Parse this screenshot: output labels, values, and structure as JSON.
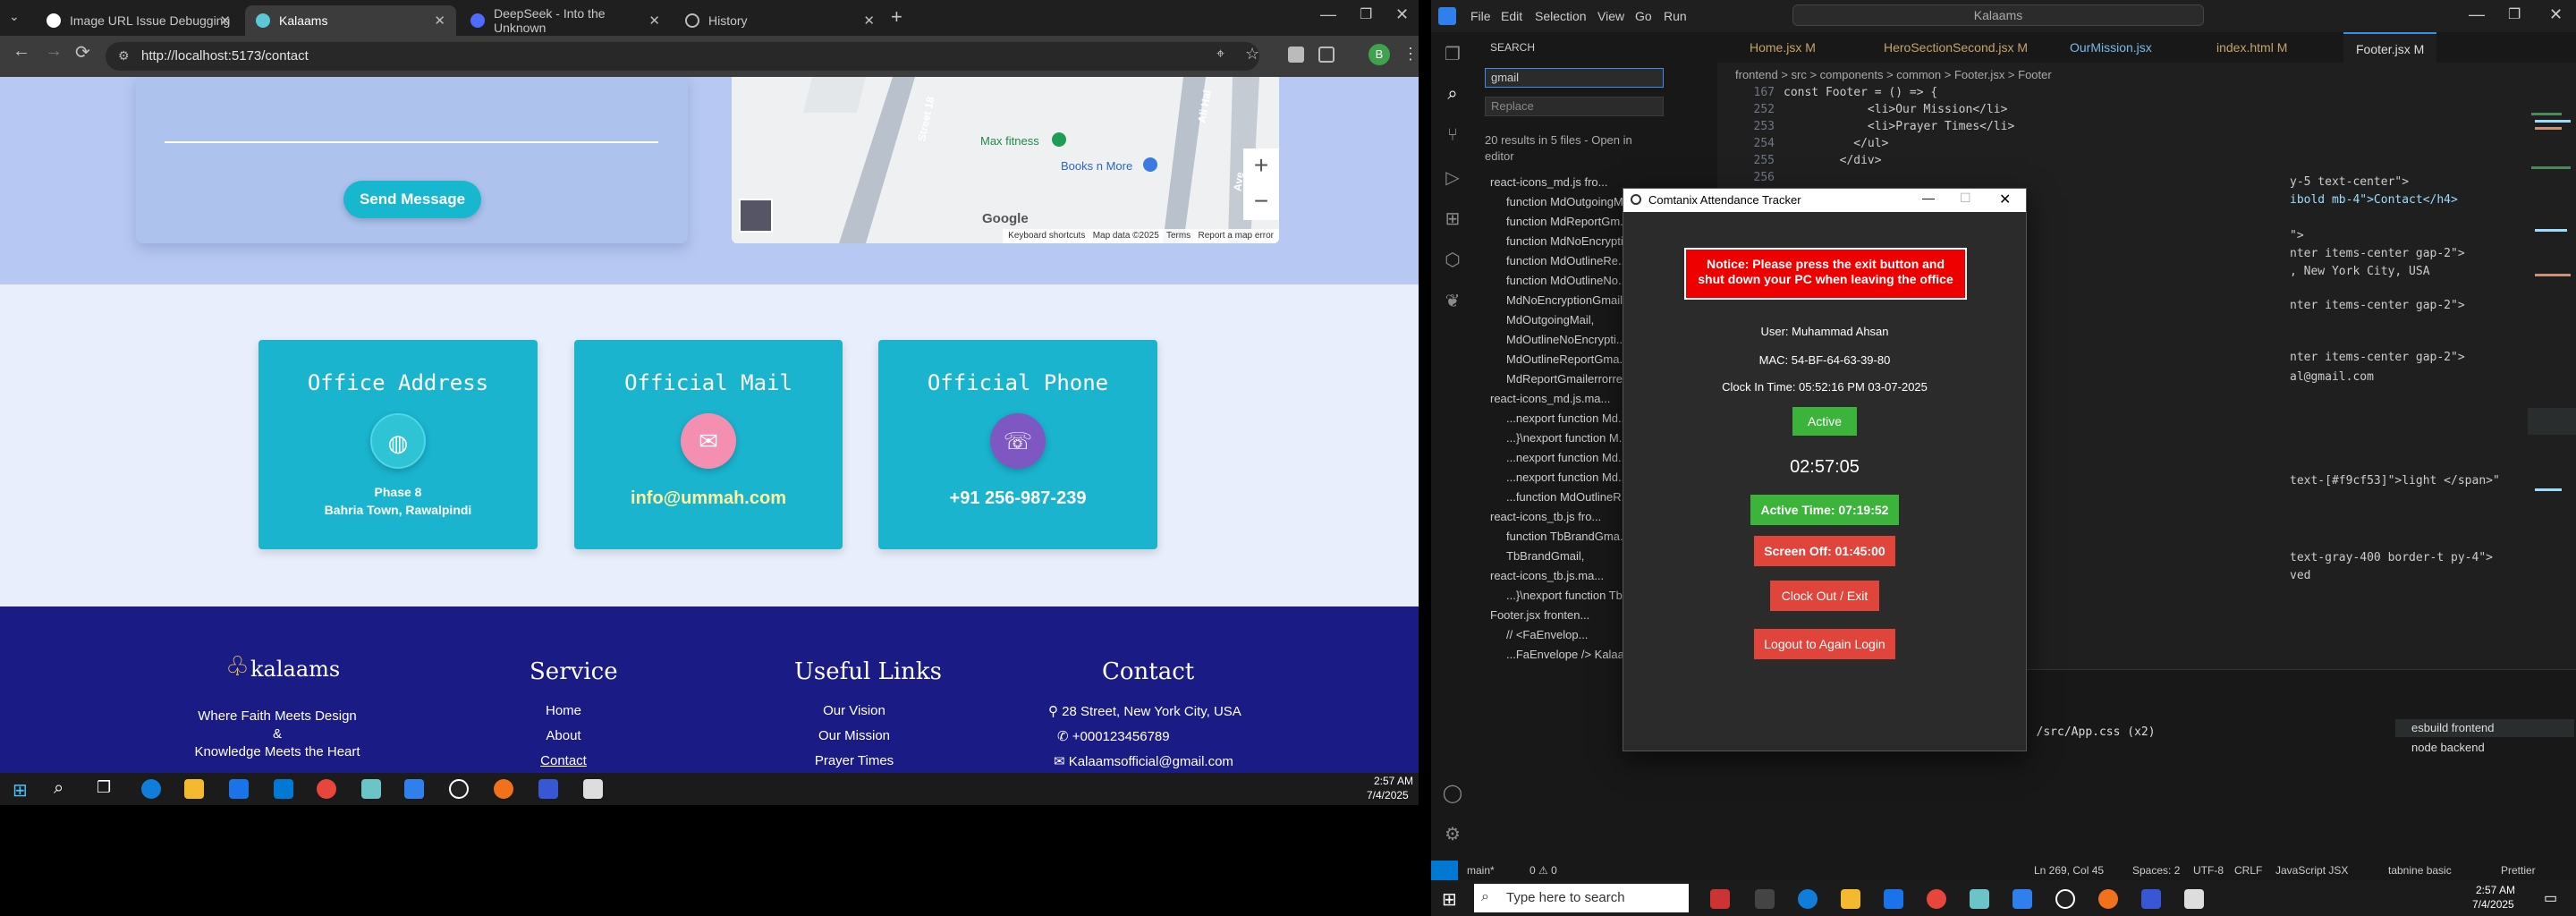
{
  "browser": {
    "tabs": [
      {
        "title": "Image URL Issue Debugging",
        "active": false
      },
      {
        "title": "Kalaams",
        "active": true
      },
      {
        "title": "DeepSeek - Into the Unknown",
        "active": false
      },
      {
        "title": "History",
        "active": false
      }
    ],
    "url": "http://localhost:5173/contact",
    "avatar_letter": "B"
  },
  "page": {
    "send_button": "Send Message",
    "map": {
      "labels": [
        "Max fitness",
        "Books n More",
        "Street 18",
        "Ali Hai",
        "Ave"
      ],
      "google": "Google",
      "footer": [
        "Keyboard shortcuts",
        "Map data ©2025",
        "Terms",
        "Report a map error"
      ],
      "zoom_in": "+",
      "zoom_out": "−"
    },
    "cards": [
      {
        "title": "Office Address",
        "lines": [
          "Phase 8",
          "Bahria Town, Rawalpindi"
        ],
        "icon_color": "#2ec4d6"
      },
      {
        "title": "Official Mail",
        "value": "info@ummah.com",
        "icon_color": "#f48fb1"
      },
      {
        "title": "Official Phone",
        "value": "+91 256-987-239",
        "icon_color": "#7e57c2"
      }
    ],
    "footer": {
      "brand": "kalaams",
      "tagline": [
        "Where Faith Meets Design",
        "&",
        "Knowledge Meets the Heart"
      ],
      "service": {
        "heading": "Service",
        "links": [
          "Home",
          "About",
          "Contact"
        ]
      },
      "useful": {
        "heading": "Useful Links",
        "links": [
          "Our Vision",
          "Our Mission",
          "Prayer Times"
        ]
      },
      "contact": {
        "heading": "Contact",
        "items": [
          "28 Street, New York City, USA",
          "+000123456789",
          "Kalaamsofficial@gmail.com"
        ]
      }
    }
  },
  "left_taskbar": {
    "time": "2:57 AM",
    "date": "7/4/2025"
  },
  "vscode": {
    "menu": [
      "File",
      "Edit",
      "Selection",
      "View",
      "Go",
      "Run"
    ],
    "search_box": "Kalaams",
    "tabs": [
      "Home.jsx M",
      "HeroSectionSecond.jsx M",
      "OurMission.jsx",
      "index.html M",
      "Footer.jsx M"
    ],
    "breadcrumb": "frontend > src > components > common > Footer.jsx > Footer",
    "search_panel": {
      "title": "SEARCH",
      "query": "gmail",
      "replace_placeholder": "Replace",
      "summary": "20 results in 5 files - Open in editor",
      "rows": [
        "react-icons_md.js fro...",
        "function MdOutgoingM...",
        "function MdReportGm...",
        "function MdNoEncrypti...",
        "function MdOutlineRe...",
        "function MdOutlineNo...",
        "MdNoEncryptionGmail...",
        "MdOutgoingMail,",
        "MdOutlineNoEncrypti...",
        "MdOutlineReportGma...",
        "MdReportGmailerrorre...",
        "react-icons_md.js.ma...",
        "...nexport function Md...",
        "...}\\nexport function M...",
        "...nexport function Md...",
        "...nexport function Md...",
        "...function MdOutlineR...",
        "react-icons_tb.js fro...",
        "function TbBrandGma...",
        "TbBrandGmail,",
        "react-icons_tb.js.ma...",
        "...}\\nexport function Tb...",
        "Footer.jsx fronten...",
        "//          <FaEnvelop...",
        "...FaEnvelope /> Kalaa..."
      ]
    },
    "code_top": [
      {
        "n": "167",
        "t": "const Footer = () => {"
      },
      {
        "n": "252",
        "t": "            <li>Our Mission</li>"
      },
      {
        "n": "253",
        "t": "            <li>Prayer Times</li>"
      },
      {
        "n": "254",
        "t": "          </ul>"
      },
      {
        "n": "255",
        "t": "        </div>"
      },
      {
        "n": "256",
        "t": ""
      }
    ],
    "code_right": [
      "y-5 text-center\">",
      "ibold mb-4\">Contact</h4>",
      "\">",
      "nter items-center gap-2\">",
      ", New York City, USA",
      "nter items-center gap-2\">",
      "nter items-center gap-2\">",
      "al@gmail.com",
      "text-[#f9cf53]\">light </span>\"",
      "text-gray-400 border-t py-4\">",
      "ved"
    ],
    "terminal_line": "/common/Footer.jsx, /src/App.css (x2)",
    "terminal_tasks": [
      "esbuild  frontend",
      "node  backend"
    ],
    "status": {
      "branch": "main*",
      "problems": "0 ⚠ 0",
      "position": "Ln 269, Col 45",
      "spaces": "Spaces: 2",
      "encoding": "UTF-8",
      "eol": "CRLF",
      "lang": "JavaScript JSX",
      "tabnine": "tabnine basic",
      "prettier": "Prettier"
    }
  },
  "dialog": {
    "title": "Comtanix Attendance Tracker",
    "notice": "Notice: Please press the exit button and shut down your PC when leaving the office",
    "user": "User: Muhammad Ahsan",
    "mac": "MAC: 54-BF-64-63-39-80",
    "clock_in": "Clock In Time: 05:52:16 PM 03-07-2025",
    "status": "Active",
    "timer": "02:57:05",
    "active_time": "Active Time: 07:19:52",
    "screen_off": "Screen Off: 01:45:00",
    "clock_out": "Clock Out / Exit",
    "logout": "Logout to Again Login"
  },
  "right_taskbar": {
    "search_placeholder": "Type here to search",
    "time": "2:57 AM",
    "date": "7/4/2025"
  }
}
